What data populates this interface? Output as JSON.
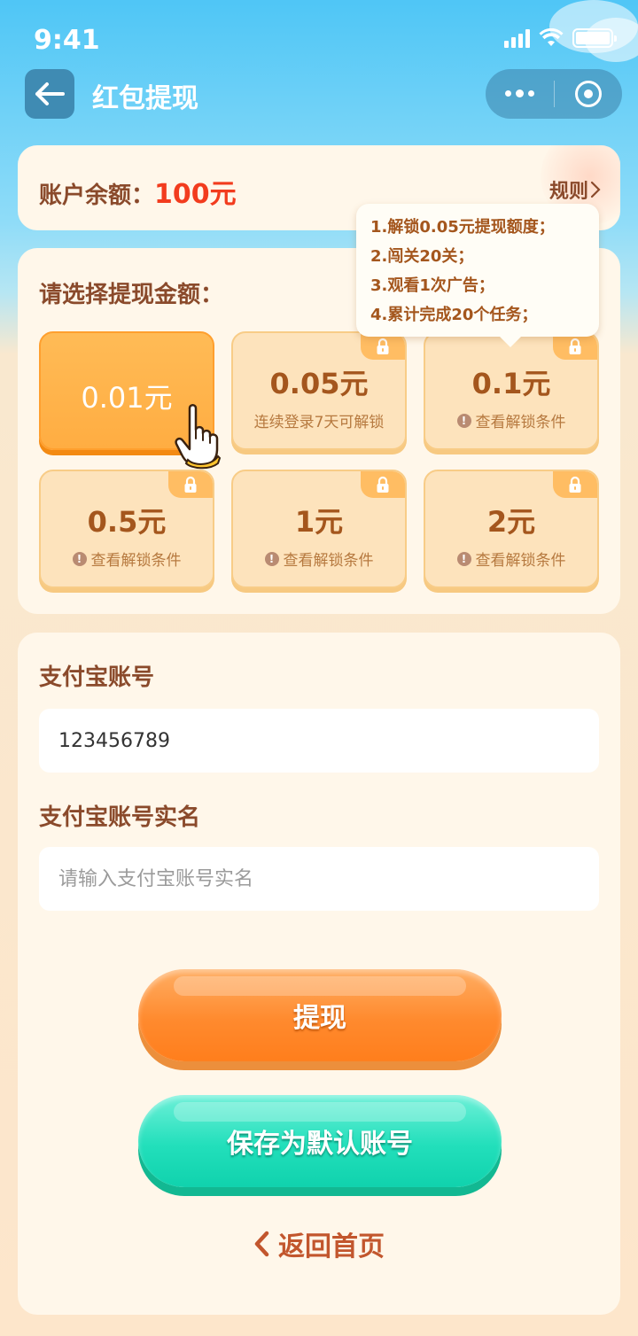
{
  "status": {
    "time": "9:41"
  },
  "nav": {
    "title": "红包提现",
    "back_icon": "arrow-left-icon",
    "more_icon": "more-dots-icon",
    "close_icon": "target-icon"
  },
  "balance": {
    "label": "账户余额：",
    "value": "100元",
    "rules": "规则"
  },
  "amount_section": {
    "title": "请选择提现金额：",
    "options": [
      {
        "value": "0.01元",
        "sub": "",
        "selected": true,
        "locked": false
      },
      {
        "value": "0.05元",
        "sub": "连续登录7天可解锁",
        "selected": false,
        "locked": true
      },
      {
        "value": "0.1元",
        "sub": "查看解锁条件",
        "selected": false,
        "locked": true
      },
      {
        "value": "0.5元",
        "sub": "查看解锁条件",
        "selected": false,
        "locked": true
      },
      {
        "value": "1元",
        "sub": "查看解锁条件",
        "selected": false,
        "locked": true
      },
      {
        "value": "2元",
        "sub": "查看解锁条件",
        "selected": false,
        "locked": true
      }
    ]
  },
  "tooltip": {
    "lines": [
      "1.解锁0.05元提现额度；",
      "2.闯关20关；",
      "3.观看1次广告；",
      "4.累计完成20个任务；"
    ]
  },
  "form": {
    "account_label": "支付宝账号",
    "account_value": "123456789",
    "name_label": "支付宝账号实名",
    "name_placeholder": "请输入支付宝账号实名"
  },
  "buttons": {
    "withdraw": "提现",
    "save": "保存为默认账号"
  },
  "home_link": "返回首页",
  "colors": {
    "accent_red": "#f23c1e",
    "brown": "#8a4a2b",
    "orange": "#ff8a2e",
    "teal": "#22dfbb"
  }
}
